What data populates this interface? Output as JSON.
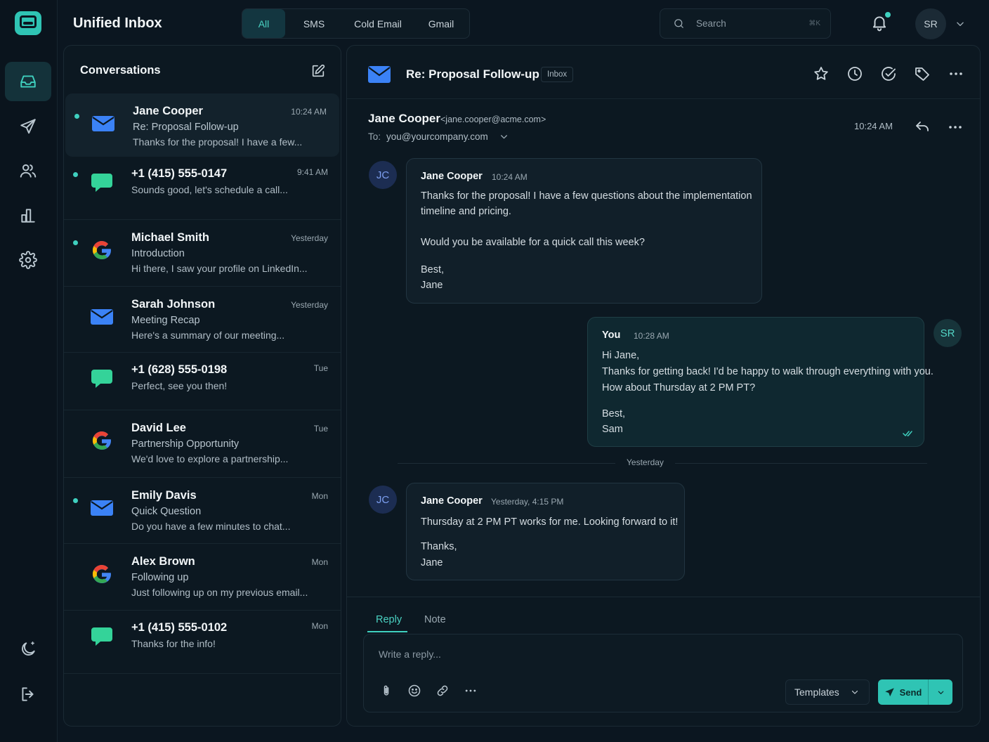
{
  "app": {
    "title": "Unified Inbox"
  },
  "tabs": [
    {
      "label": "All",
      "active": true
    },
    {
      "label": "SMS",
      "active": false
    },
    {
      "label": "Cold Email",
      "active": false
    },
    {
      "label": "Gmail",
      "active": false
    }
  ],
  "search": {
    "placeholder": "Search",
    "shortcut": "⌘K"
  },
  "user": {
    "initials": "SR"
  },
  "rail": {
    "items": [
      {
        "icon": "inbox-icon",
        "active": true
      },
      {
        "icon": "send-icon"
      },
      {
        "icon": "contacts-icon"
      },
      {
        "icon": "analytics-icon"
      },
      {
        "icon": "settings-icon"
      }
    ],
    "bottom": [
      {
        "icon": "moon-icon"
      },
      {
        "icon": "logout-icon"
      }
    ]
  },
  "conversations": {
    "heading": "Conversations",
    "items": [
      {
        "channel": "email",
        "name": "Jane Cooper",
        "subject": "Re: Proposal Follow-up",
        "preview": "Thanks for the proposal! I have a few...",
        "time": "10:24 AM",
        "unread": true,
        "selected": true
      },
      {
        "channel": "sms",
        "name": "+1 (415) 555-0147",
        "subject": "",
        "preview": "Sounds good, let's schedule a call...",
        "time": "9:41 AM",
        "unread": true
      },
      {
        "channel": "gmail",
        "name": "Michael Smith",
        "subject": "Introduction",
        "preview": "Hi there, I saw your profile on LinkedIn...",
        "time": "Yesterday",
        "unread": true
      },
      {
        "channel": "email",
        "name": "Sarah Johnson",
        "subject": "Meeting Recap",
        "preview": "Here's a summary of our meeting...",
        "time": "Yesterday",
        "unread": false
      },
      {
        "channel": "sms",
        "name": "+1 (628) 555-0198",
        "subject": "",
        "preview": "Perfect, see you then!",
        "time": "Tue",
        "unread": false
      },
      {
        "channel": "gmail",
        "name": "David Lee",
        "subject": "Partnership Opportunity",
        "preview": "We'd love to explore a partnership...",
        "time": "Tue",
        "unread": false
      },
      {
        "channel": "email",
        "name": "Emily Davis",
        "subject": "Quick Question",
        "preview": "Do you have a few minutes to chat...",
        "time": "Mon",
        "unread": true
      },
      {
        "channel": "gmail",
        "name": "Alex Brown",
        "subject": "Following up",
        "preview": "Just following up on my previous email...",
        "time": "Mon",
        "unread": false
      },
      {
        "channel": "sms",
        "name": "+1 (415) 555-0102",
        "subject": "",
        "preview": "Thanks for the info!",
        "time": "Mon",
        "unread": false
      }
    ]
  },
  "thread": {
    "title": "Re: Proposal Follow-up",
    "badge": "Inbox",
    "from_name": "Jane Cooper",
    "from_email": "<jane.cooper@acme.com>",
    "to_label": "To:",
    "to_address": "you@yourcompany.com",
    "time": "10:24 AM",
    "messages": [
      {
        "initials": "JC",
        "author": "Jane Cooper",
        "time": "10:24 AM",
        "lines": [
          "Thanks for the proposal! I have a few questions about the implementation",
          "timeline and pricing.",
          "Would you be available for a quick call this week?",
          "Best,",
          "Jane"
        ]
      },
      {
        "initials": "SR",
        "author": "You",
        "time": "10:28 AM",
        "lines": [
          "Hi Jane,",
          "Thanks for getting back! I'd be happy to walk through everything with you.",
          "How about Thursday at 2 PM PT?",
          "Best,",
          "Sam"
        ]
      },
      {
        "initials": "JC",
        "author": "Jane Cooper",
        "time": "Yesterday, 4:15 PM",
        "lines": [
          "Thursday at 2 PM PT works for me. Looking forward to it!",
          "Thanks,",
          "Jane"
        ]
      }
    ],
    "divider": "Yesterday"
  },
  "composer": {
    "tabs": [
      "Reply",
      "Note"
    ],
    "placeholder": "Write a reply...",
    "templates_label": "Templates",
    "send_label": "Send"
  },
  "colors": {
    "accent": "#3fd0bf",
    "background": "#0b1620",
    "panel": "#0c1821"
  }
}
